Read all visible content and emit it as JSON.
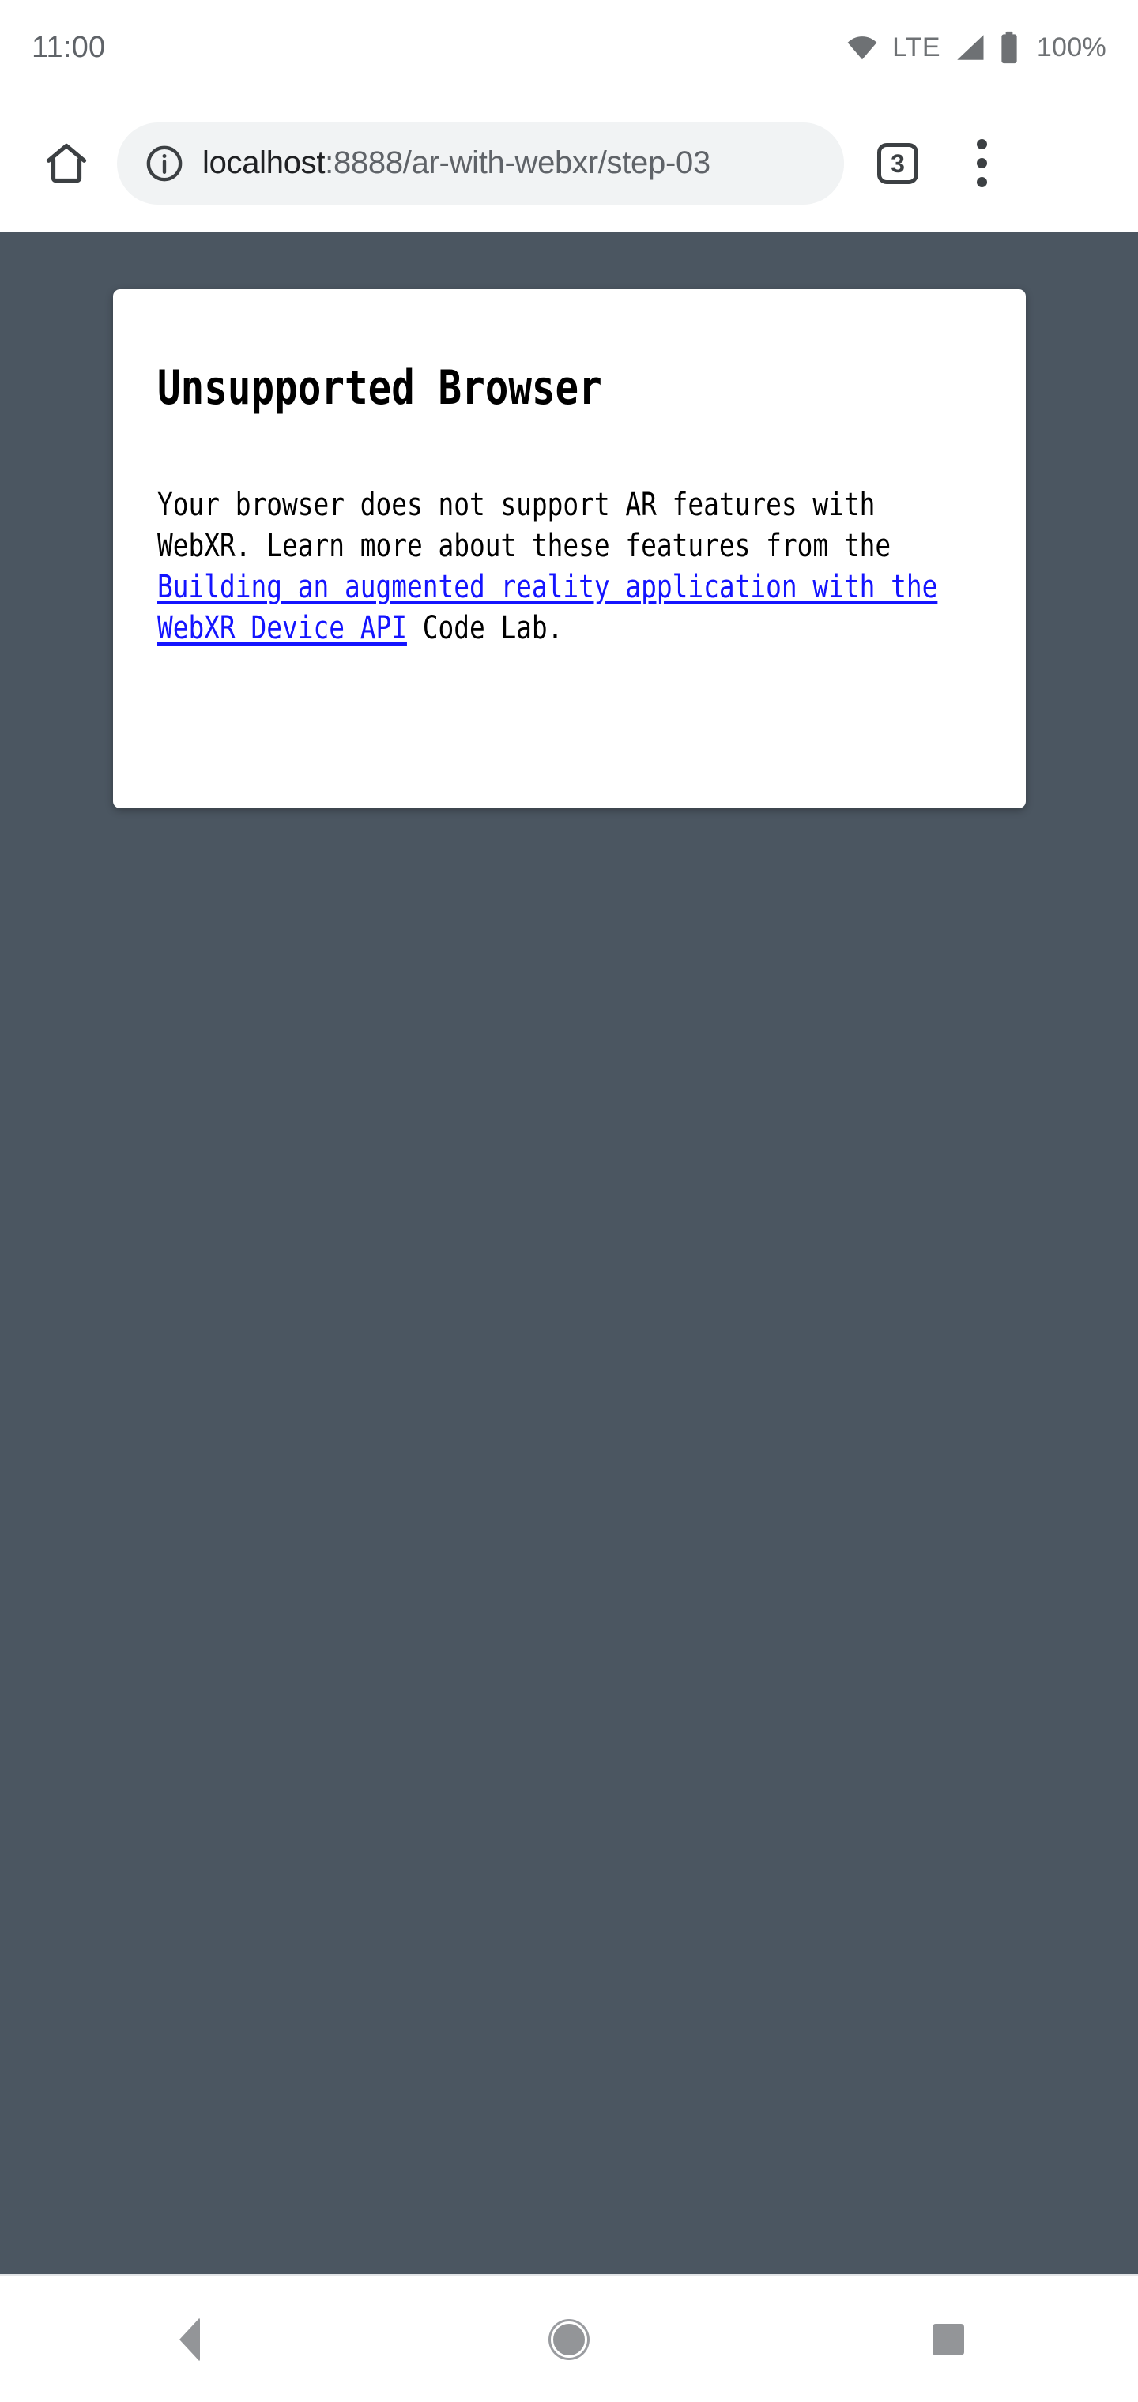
{
  "status_bar": {
    "clock": "11:00",
    "network_label": "LTE",
    "battery_percent": "100%",
    "icons": [
      "wifi-icon",
      "cell-signal-icon",
      "battery-icon"
    ]
  },
  "browser": {
    "home_icon": "home-icon",
    "info_icon": "page-info-icon",
    "url_host": "localhost",
    "url_path": ":8888/ar-with-webxr/step-03",
    "url_full": "localhost:8888/ar-with-webxr/step-03",
    "tab_count": "3",
    "menu_icon": "overflow-menu-icon"
  },
  "page": {
    "background_color": "#4b5661",
    "card": {
      "title": "Unsupported Browser",
      "body_before_link": "Your browser does not support AR features with WebXR. Learn more about these features from the ",
      "link_text": "Building an augmented reality application with the WebXR Device API",
      "link_color": "#1414ff",
      "body_after_link": " Code Lab."
    }
  },
  "nav_bar": {
    "back_label": "back-button",
    "home_label": "home-button",
    "recents_label": "recents-button"
  }
}
